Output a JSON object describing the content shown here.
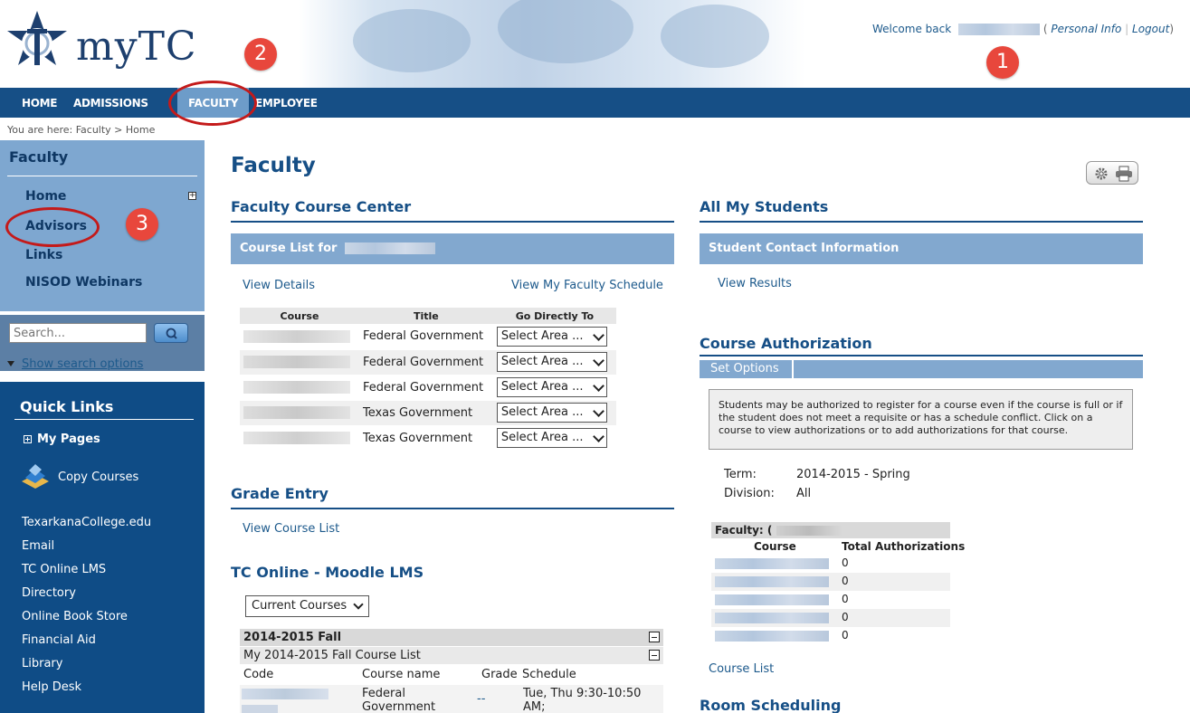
{
  "header": {
    "logo_text": "myTC",
    "welcome_text": "Welcome back",
    "personal_info": "Personal Info",
    "logout": "Logout",
    "annotation_1": "1",
    "annotation_2": "2",
    "annotation_3": "3"
  },
  "nav": {
    "items": [
      {
        "label": "HOME"
      },
      {
        "label": "ADMISSIONS"
      },
      {
        "label": "FACULTY"
      },
      {
        "label": "EMPLOYEE"
      }
    ]
  },
  "breadcrumb": "You are here:  Faculty > Home",
  "sidebar": {
    "title": "Faculty",
    "links": [
      {
        "label": "Home"
      },
      {
        "label": "Advisors"
      },
      {
        "label": "Links"
      },
      {
        "label": "NISOD Webinars"
      }
    ],
    "search_placeholder": "Search...",
    "search_options": "Show search options",
    "quick_links_title": "Quick Links",
    "my_pages": "My Pages",
    "copy_courses": "Copy Courses",
    "quick_links": [
      {
        "label": "TexarkanaCollege.edu"
      },
      {
        "label": "Email"
      },
      {
        "label": "TC Online LMS"
      },
      {
        "label": "Directory"
      },
      {
        "label": "Online Book Store"
      },
      {
        "label": "Financial Aid"
      },
      {
        "label": "Library"
      },
      {
        "label": "Help Desk"
      }
    ]
  },
  "main": {
    "page_title": "Faculty",
    "course_center": {
      "title": "Faculty Course Center",
      "bar_label": "Course List for",
      "view_details": "View Details",
      "view_schedule": "View My Faculty Schedule",
      "columns": [
        "Course",
        "Title",
        "Go Directly To"
      ],
      "rows": [
        {
          "title": "Federal Government",
          "select": "Select Area ..."
        },
        {
          "title": "Federal Government",
          "select": "Select Area ..."
        },
        {
          "title": "Federal Government",
          "select": "Select Area ..."
        },
        {
          "title": "Texas Government",
          "select": "Select Area ..."
        },
        {
          "title": "Texas Government",
          "select": "Select Area ..."
        }
      ]
    },
    "grade_entry": {
      "title": "Grade Entry",
      "link": "View Course List"
    },
    "moodle": {
      "title": "TC Online - Moodle LMS",
      "select_value": "Current Courses",
      "term": "2014-2015 Fall",
      "list_label": "My 2014-2015 Fall Course List",
      "columns": [
        "Code",
        "Course name",
        "Grade",
        "Schedule"
      ],
      "row": {
        "course_name": "Federal Government",
        "grade": "--",
        "schedule": "Tue, Thu 9:30-10:50 AM;"
      }
    }
  },
  "right": {
    "all_students": {
      "title": "All My Students",
      "bar_label": "Student Contact Information",
      "link": "View Results"
    },
    "course_auth": {
      "title": "Course Authorization",
      "tab": "Set Options",
      "info": "Students may be authorized to register for a course even if the course is full or if the student does not meet a requisite or has a schedule conflict. Click on a course to view authorizations or to add authorizations for that course.",
      "term_label": "Term:",
      "term_value": "2014-2015 - Spring",
      "division_label": "Division:",
      "division_value": "All",
      "faculty_label": "Faculty: (",
      "columns": [
        "Course",
        "Total Authorizations"
      ],
      "counts": [
        "0",
        "0",
        "0",
        "0",
        "0"
      ],
      "course_list_link": "Course List"
    },
    "room_scheduling": {
      "title": "Room Scheduling"
    }
  }
}
